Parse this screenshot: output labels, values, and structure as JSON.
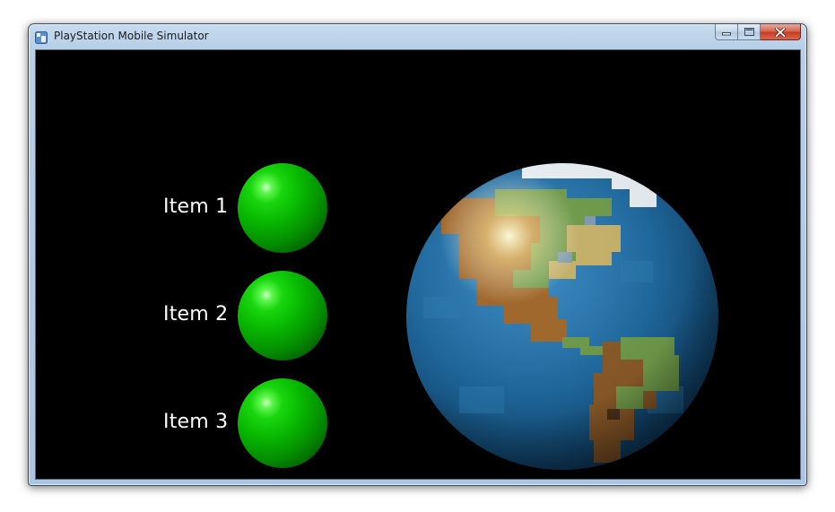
{
  "window": {
    "title": "PlayStation Mobile Simulator",
    "icons": {
      "app": "playstation-mobile-app-icon",
      "minimize": "minimize-icon",
      "maximize": "maximize-icon",
      "close": "close-icon"
    },
    "colors": {
      "client_background": "#000000",
      "close_button": "#c43b22",
      "titlebar": "#b7cfe7"
    }
  },
  "scene": {
    "items": [
      {
        "label": "Item 1",
        "color": "#07b600"
      },
      {
        "label": "Item 2",
        "color": "#07b600"
      },
      {
        "label": "Item 3",
        "color": "#07b600"
      }
    ],
    "globe": {
      "name": "earth-globe",
      "ocean_color": "#1f6aa0",
      "land_color": "#6f9a4a"
    }
  }
}
